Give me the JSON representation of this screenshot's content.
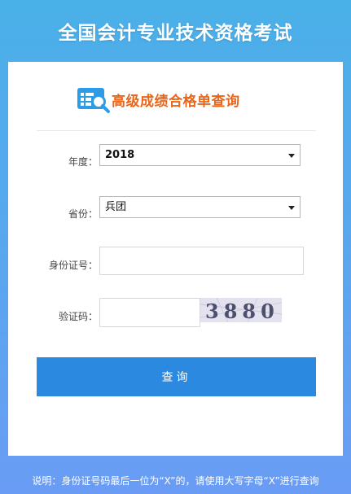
{
  "header": {
    "title": "全国会计专业技术资格考试"
  },
  "logo": {
    "text": "高级成绩合格单查询",
    "icon": "search-document-icon"
  },
  "form": {
    "year_label": "年度：",
    "year_value": "2018",
    "province_label": "省份：",
    "province_value": "兵团",
    "id_label": "身份证号：",
    "id_value": "",
    "captcha_label": "验证码：",
    "captcha_value": "",
    "captcha_image_text": "3880"
  },
  "actions": {
    "query_label": "查询"
  },
  "footer": {
    "note": "说明：身份证号码最后一位为“X”的，请使用大写字母“X”进行查询"
  },
  "colors": {
    "background_top": "#4ab0e8",
    "background_bottom": "#6a9cf5",
    "button": "#2b8ae0",
    "logo_text": "#e8661b"
  }
}
